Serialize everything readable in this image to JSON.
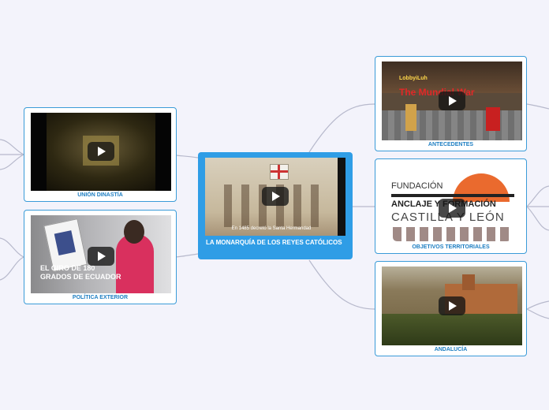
{
  "central": {
    "label": "LA MONARQUÍA DE LOS REYES CATÓLICOS",
    "video_caption": "En 1485 decretó la Santa Hermandad"
  },
  "nodes": {
    "union": {
      "label": "UNIÓN DINASTÍA"
    },
    "exterior": {
      "label": "POLÍTICA EXTERIOR",
      "video_text": "EL GIRO DE 180 GRADOS DE ECUADOR"
    },
    "antecedentes": {
      "label": "ANTECEDENTES",
      "video_title": "The Mundial War",
      "video_user": "LobbyiLuh"
    },
    "objetivos": {
      "label": "OBJETIVOS TERRITORIALES",
      "logo_line1": "FUNDACIÓN",
      "logo_line2": "ANCLAJE Y FORMACIÓN",
      "logo_line3": "CASTILLA Y LEÓN"
    },
    "andalucia": {
      "label": "ANDALUCÍA"
    }
  },
  "icons": [
    "play-icon"
  ],
  "colors": {
    "accent": "#2f9de6",
    "node_border": "#3a9bd8",
    "label": "#1d7ec2",
    "connector": "#b7b9cc"
  }
}
